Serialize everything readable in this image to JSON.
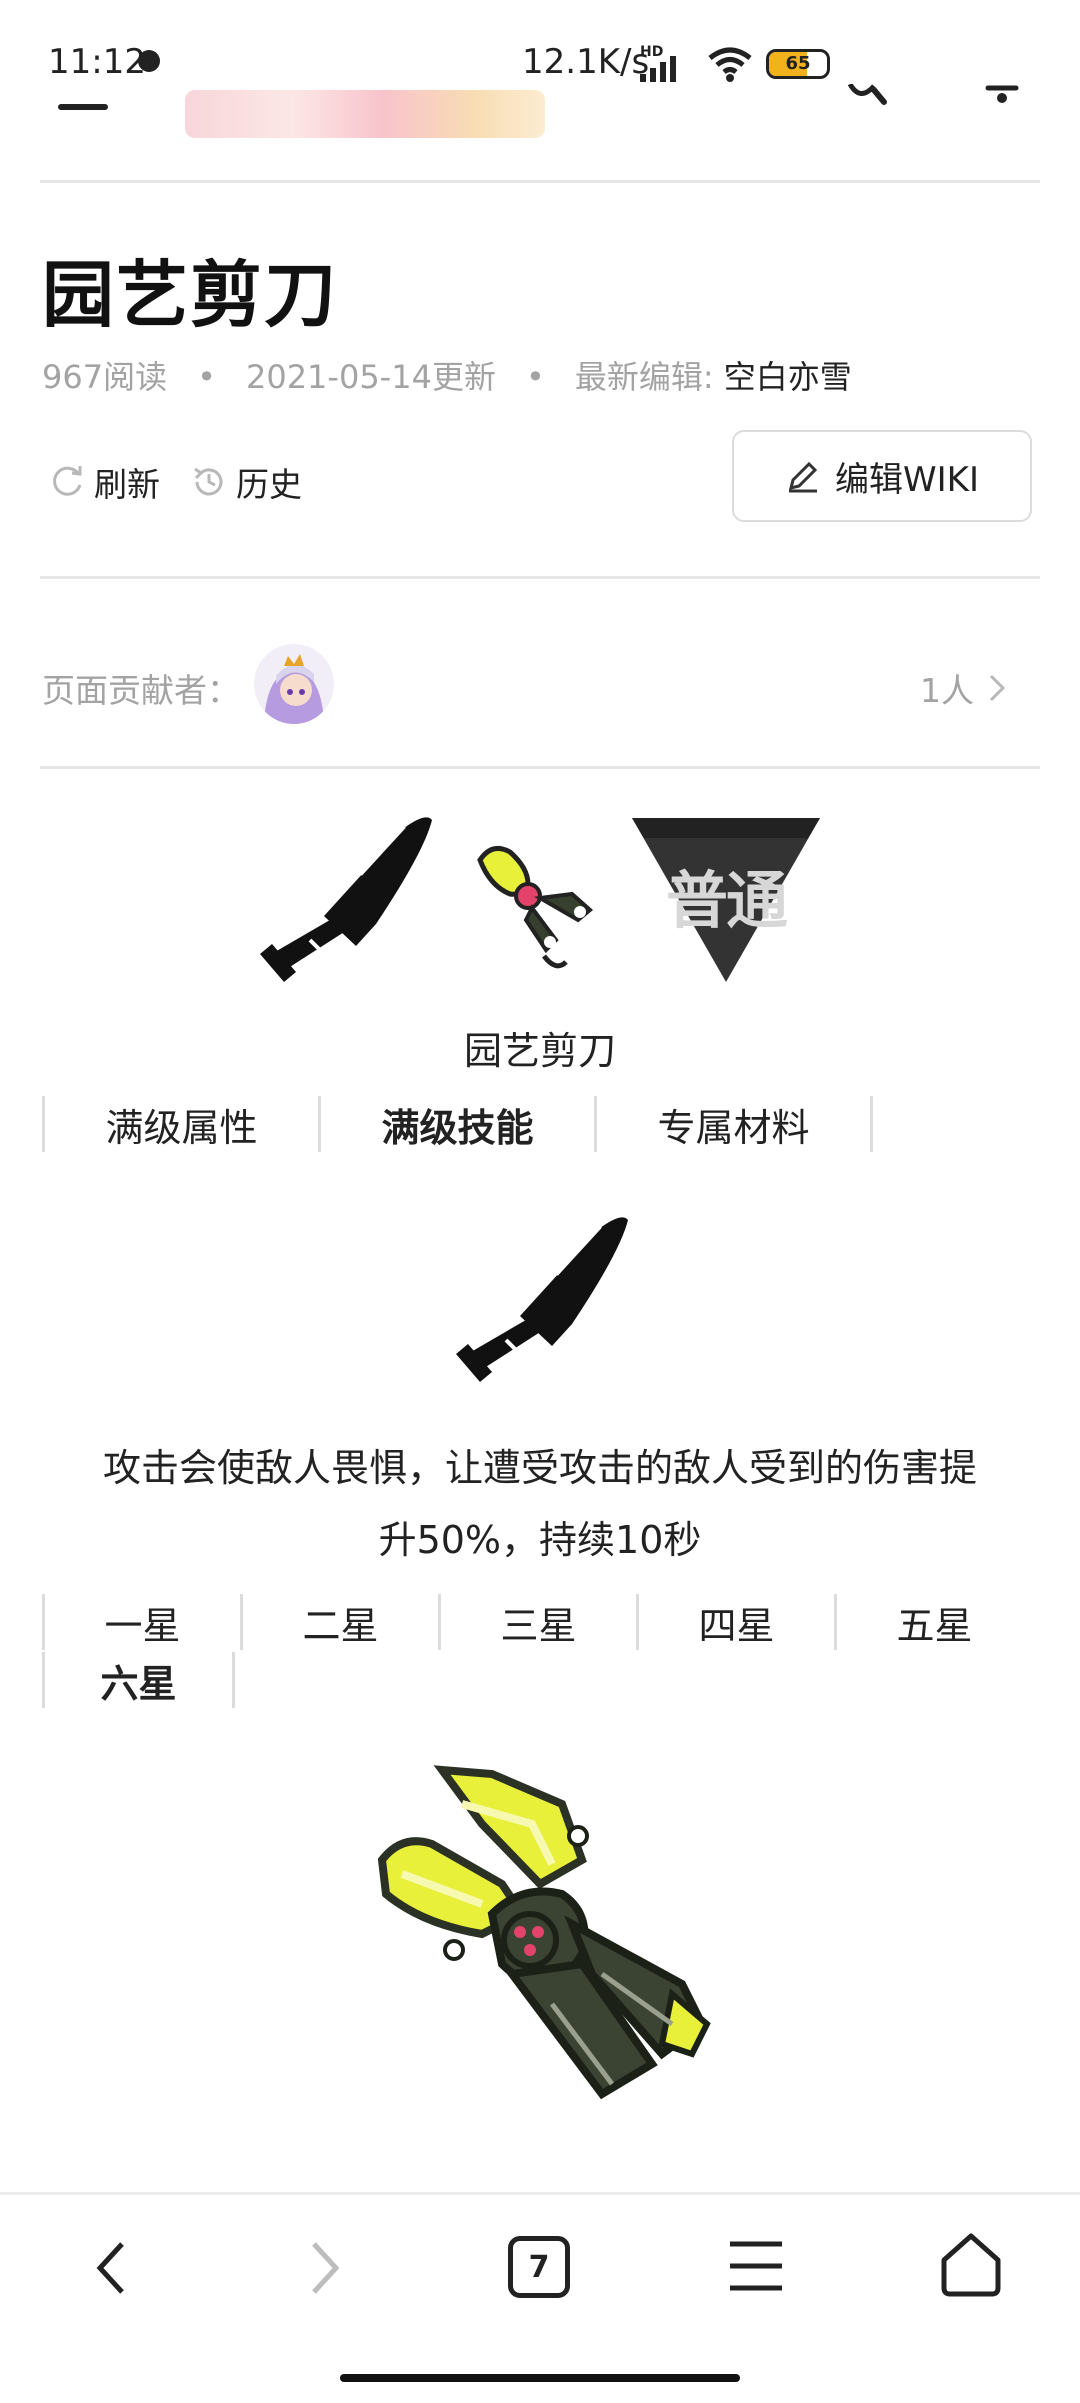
{
  "status_bar": {
    "time": "11:12",
    "network_speed": "12.1K/s",
    "hd_label": "HD",
    "battery_level": 65,
    "battery_label": "65"
  },
  "page": {
    "title": "园艺剪刀",
    "reads": "967阅读",
    "updated": "2021-05-14更新",
    "editor_label": "最新编辑:",
    "editor_name": "空白亦雪",
    "meta_separator": "•"
  },
  "actions": {
    "refresh_label": "刷新",
    "history_label": "历史",
    "edit_label": "编辑WIKI"
  },
  "contributors": {
    "label": "页面贡献者：",
    "count": "1人"
  },
  "item": {
    "name": "园艺剪刀",
    "rarity_badge": "普通",
    "type_icon": "sword-icon",
    "tabs": [
      {
        "label": "满级属性",
        "active": false
      },
      {
        "label": "满级技能",
        "active": true
      },
      {
        "label": "专属材料",
        "active": false
      }
    ],
    "skill_description": "攻击会使敌人畏惧，让遭受攻击的敌人受到的伤害提升50%，持续10秒",
    "star_tabs": [
      {
        "label": "一星",
        "active": false
      },
      {
        "label": "二星",
        "active": false
      },
      {
        "label": "三星",
        "active": false
      },
      {
        "label": "四星",
        "active": false
      },
      {
        "label": "五星",
        "active": false
      },
      {
        "label": "六星",
        "active": true
      }
    ]
  },
  "bottom_nav": {
    "tab_count": "7",
    "icons": [
      "back-icon",
      "forward-icon",
      "tabs-icon",
      "menu-icon",
      "home-icon"
    ]
  },
  "colors": {
    "accent_yellow": "#e8f03a",
    "battery": "#f2b21c",
    "muted_text": "#a3a3a3",
    "divider": "#e6e6e6"
  }
}
